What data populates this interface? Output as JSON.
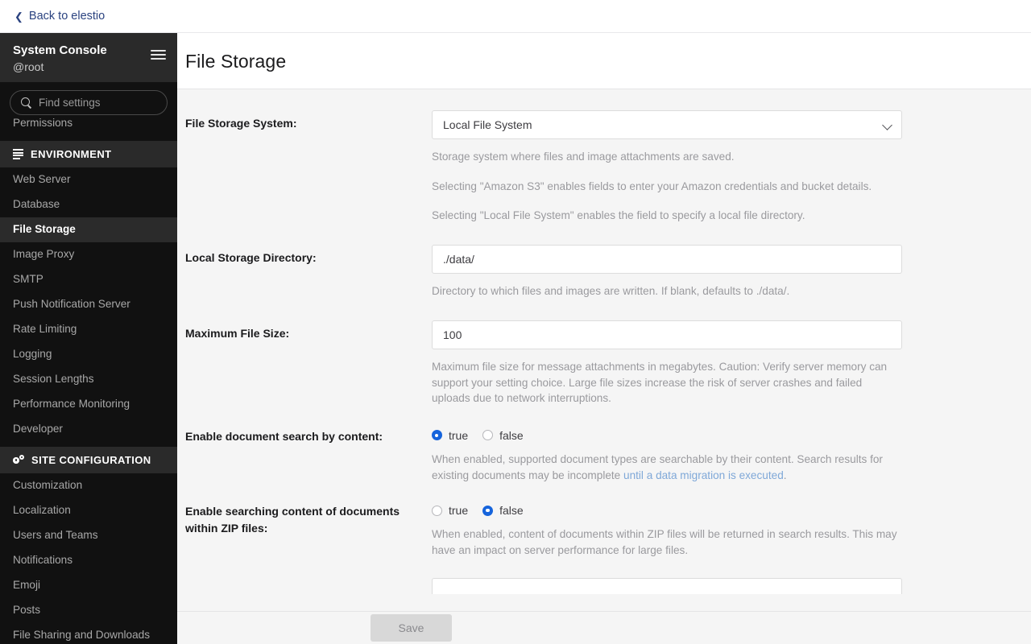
{
  "topbar": {
    "back_label": "Back to elestio",
    "back_icon": "chevron-left-icon",
    "link_color": "#2b4380"
  },
  "sidebar": {
    "title": "System Console",
    "user": "@root",
    "menu_icon": "hamburger-icon",
    "search": {
      "placeholder": "Find settings",
      "icon": "search-icon",
      "value": ""
    },
    "clipped_item_above": "Permissions",
    "sections": [
      {
        "label": "ENVIRONMENT",
        "icon": "stacked-layers-icon",
        "items": [
          {
            "label": "Web Server",
            "active": false
          },
          {
            "label": "Database",
            "active": false
          },
          {
            "label": "File Storage",
            "active": true
          },
          {
            "label": "Image Proxy",
            "active": false
          },
          {
            "label": "SMTP",
            "active": false
          },
          {
            "label": "Push Notification Server",
            "active": false
          },
          {
            "label": "Rate Limiting",
            "active": false
          },
          {
            "label": "Logging",
            "active": false
          },
          {
            "label": "Session Lengths",
            "active": false
          },
          {
            "label": "Performance Monitoring",
            "active": false
          },
          {
            "label": "Developer",
            "active": false
          }
        ]
      },
      {
        "label": "SITE CONFIGURATION",
        "icon": "gears-icon",
        "items": [
          {
            "label": "Customization",
            "active": false
          },
          {
            "label": "Localization",
            "active": false
          },
          {
            "label": "Users and Teams",
            "active": false
          },
          {
            "label": "Notifications",
            "active": false
          },
          {
            "label": "Emoji",
            "active": false
          },
          {
            "label": "Posts",
            "active": false
          },
          {
            "label": "File Sharing and Downloads",
            "active": false
          }
        ]
      }
    ]
  },
  "page": {
    "title": "File Storage"
  },
  "form": {
    "file_storage_system": {
      "label": "File Storage System:",
      "value": "Local File System",
      "options": [
        "Local File System",
        "Amazon S3"
      ],
      "chevron_icon": "chevron-down-icon",
      "help": [
        "Storage system where files and image attachments are saved.",
        "Selecting \"Amazon S3\" enables fields to enter your Amazon credentials and bucket details.",
        "Selecting \"Local File System\" enables the field to specify a local file directory."
      ]
    },
    "local_storage_directory": {
      "label": "Local Storage Directory:",
      "value": "./data/",
      "placeholder": "",
      "help": "Directory to which files and images are written. If blank, defaults to ./data/."
    },
    "maximum_file_size": {
      "label": "Maximum File Size:",
      "value": "100",
      "placeholder": "",
      "help": "Maximum file size for message attachments in megabytes. Caution: Verify server memory can support your setting choice. Large file sizes increase the risk of server crashes and failed uploads due to network interruptions."
    },
    "document_search": {
      "label": "Enable document search by content:",
      "true_label": "true",
      "false_label": "false",
      "selected": "true",
      "help_before_link": "When enabled, supported document types are searchable by their content. Search results for existing documents may be incomplete ",
      "help_link": "until a data migration is executed",
      "help_after_link": "."
    },
    "zip_search": {
      "label": "Enable searching content of documents within ZIP files:",
      "true_label": "true",
      "false_label": "false",
      "selected": "false",
      "help": "When enabled, content of documents within ZIP files will be returned in search results. This may have an impact on server performance for large files."
    }
  },
  "footer": {
    "save_label": "Save",
    "save_disabled": true
  },
  "colors": {
    "accent_blue": "#1664dc",
    "link_blue": "#7fa8d8",
    "sidebar_bg": "#111111",
    "sidebar_header_bg": "#2a2a2a",
    "content_bg": "#f5f5f5"
  }
}
